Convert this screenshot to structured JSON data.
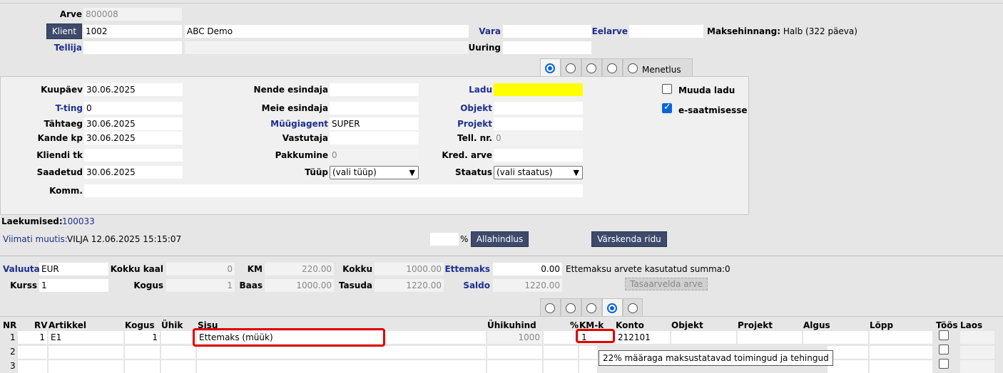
{
  "header": {
    "arve_label": "Arve",
    "arve_value": "800008",
    "klient_button": "Klient",
    "klient_code": "1002",
    "klient_name": "ABC Demo",
    "tellija_label": "Tellija",
    "vara_label": "Vara",
    "uuring_label": "Uuring",
    "eelarve_label": "Eelarve",
    "maksehinnang": "Maksehinnang:",
    "maksehinnang_value": "Halb (322 päeva)"
  },
  "tabs_top": {
    "last_label": "Menetlus"
  },
  "form": {
    "kuupaev_label": "Kuupäev",
    "kuupaev": "30.06.2025",
    "tting_label": "T-ting",
    "tting": "0",
    "tahtaeg_label": "Tähtaeg",
    "tahtaeg": "30.06.2025",
    "kandekp_label": "Kande kp",
    "kandekp": "30.06.2025",
    "klienditk_label": "Kliendi tk",
    "saadetud_label": "Saadetud",
    "saadetud": "30.06.2025",
    "komm_label": "Komm.",
    "nende_label": "Nende esindaja",
    "meie_label": "Meie esindaja",
    "myygiagent_label": "Müügiagent",
    "myygiagent": "SUPER",
    "vastutaja_label": "Vastutaja",
    "pakkumine_label": "Pakkumine",
    "pakkumine": "0",
    "tyyp_label": "Tüüp",
    "tyyp": "(vali tüüp)",
    "ladu_label": "Ladu",
    "objekt_label": "Objekt",
    "projekt_label": "Projekt",
    "tellnr_label": "Tell. nr.",
    "tellnr": "0",
    "kredarve_label": "Kred. arve",
    "staatus_label": "Staatus",
    "staatus": "(vali staatus)",
    "muuda_ladu": "Muuda ladu",
    "esaatmisesse": "e-saatmisesse"
  },
  "status": {
    "laekumised_label": "Laekumised:",
    "laekumised": "100033",
    "viimati_label": "Viimati muutis:",
    "viimati": "VILJA 12.06.2025 15:15:07",
    "percent": "%",
    "allahindlus": "Allahindlus",
    "varskenda": "Värskenda ridu"
  },
  "totals": {
    "valuuta_label": "Valuuta",
    "valuuta": "EUR",
    "kurss_label": "Kurss",
    "kurss": "1",
    "kokkukaal_label": "Kokku kaal",
    "kokkukaal": "0",
    "kogus_label": "Kogus",
    "kogus": "1",
    "km_label": "KM",
    "km": "220.00",
    "baas_label": "Baas",
    "baas": "1000.00",
    "kokku_label": "Kokku",
    "kokku": "1000.00",
    "tasuda_label": "Tasuda",
    "tasuda": "1220.00",
    "ettemaks_label": "Ettemaks",
    "ettemaks": "0.00",
    "saldo_label": "Saldo",
    "saldo": "1220.00",
    "ettemaksu_text": "Ettemaksu arvete kasutatud summa:",
    "ettemaksu_value": "0",
    "tasaarvelda": "Tasaarvelda arve"
  },
  "grid": {
    "headers": {
      "nr": "NR",
      "rv": "RV",
      "artikkel": "Artikkel",
      "kogus": "Kogus",
      "yhik": "Ühik",
      "sisu": "Sisu",
      "yhikuhind": "Ühikuhind",
      "pct": "%",
      "kmk": "KM-k",
      "konto": "Konto",
      "objekt": "Objekt",
      "projekt": "Projekt",
      "algus": "Algus",
      "lopp": "Lõpp",
      "toos": "Töös",
      "laos": "Laos"
    },
    "rows": [
      {
        "nr": "1",
        "rv": "1",
        "artikkel": "E1",
        "kogus": "1",
        "sisu": "Ettemaks (müük)",
        "yhikuhind": "1000",
        "kmk": "1",
        "konto": "212101"
      },
      {
        "nr": "2"
      },
      {
        "nr": "3"
      }
    ],
    "tooltip": "22% määraga maksustatavad toimingud ja tehingud"
  }
}
